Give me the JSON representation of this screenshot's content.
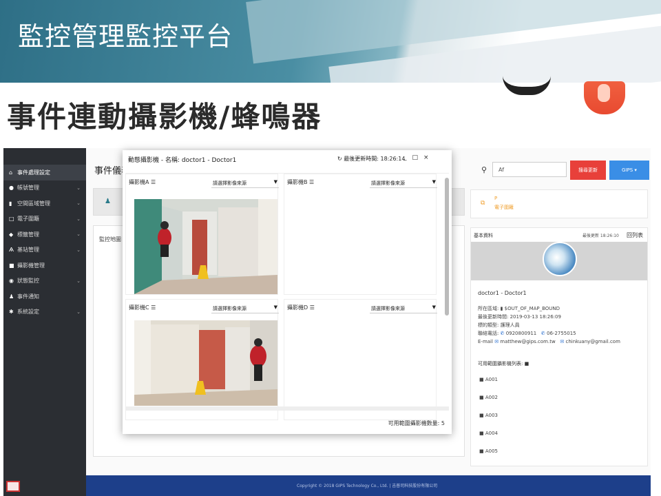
{
  "slide": {
    "title": "監控管理監控平台",
    "subtitle": "事件連動攝影機/蜂鳴器"
  },
  "sidebar": {
    "items": [
      {
        "label": "事件處理設定",
        "icon": "home-icon",
        "active": true
      },
      {
        "label": "帳號管理",
        "icon": "users-icon"
      },
      {
        "label": "空間區域管理",
        "icon": "map-icon"
      },
      {
        "label": "電子圍籬",
        "icon": "fence-icon"
      },
      {
        "label": "標籤管理",
        "icon": "tag-icon"
      },
      {
        "label": "基站管理",
        "icon": "antenna-icon"
      },
      {
        "label": "攝影機管理",
        "icon": "camera-icon"
      },
      {
        "label": "狀態監控",
        "icon": "eye-icon"
      },
      {
        "label": "事件通知",
        "icon": "bell-icon"
      },
      {
        "label": "系統設定",
        "icon": "gear-icon"
      }
    ]
  },
  "main": {
    "title": "事件儀表",
    "map_label": "監控地圖",
    "search_value": "Af",
    "btn_red": "搜尋更新",
    "btn_blue": "GIPS ▾",
    "alert": {
      "line1": "P",
      "line2": "電子圍籬"
    }
  },
  "info": {
    "heading": "基本資料",
    "updated": "最後更新 18:26:10",
    "back_list": "回列表",
    "name": "doctor1 - Doctor1",
    "area_label": "所在區域:",
    "area_value": "$OUT_OF_MAP_BOUND",
    "last_update_label": "最後更新時間:",
    "last_update_value": "2019-03-13 18:26:09",
    "type_label": "標的類型:",
    "type_value": "護理人員",
    "phone_label": "聯絡電話:",
    "phone1": "0920800911",
    "phone2": "06-2755015",
    "email_label": "E-mail",
    "email1": "matthew@gips.com.tw",
    "email2": "chinkuany@gmail.com",
    "camera_list_heading": "可用範圍攝影機列表:",
    "cameras": [
      "A001",
      "A002",
      "A003",
      "A004",
      "A005"
    ]
  },
  "modal": {
    "title": "動態攝影機 - 名稱: doctor1 - Doctor1",
    "last_update": "最後更新時間: 18:26:14",
    "quads": [
      {
        "label": "攝影機A",
        "select": "請選擇影像來源",
        "has_video": true
      },
      {
        "label": "攝影機B",
        "select": "請選擇影像來源",
        "has_video": false
      },
      {
        "label": "攝影機C",
        "select": "請選擇影像來源",
        "has_video": true
      },
      {
        "label": "攝影機D",
        "select": "請選擇影像來源",
        "has_video": false
      }
    ],
    "footer": "可用範圍攝影機數量: 5"
  },
  "footer": {
    "copyright": "Copyright © 2018 GIPS Technology Co., Ltd. | 吉普司科技股份有限公司"
  }
}
